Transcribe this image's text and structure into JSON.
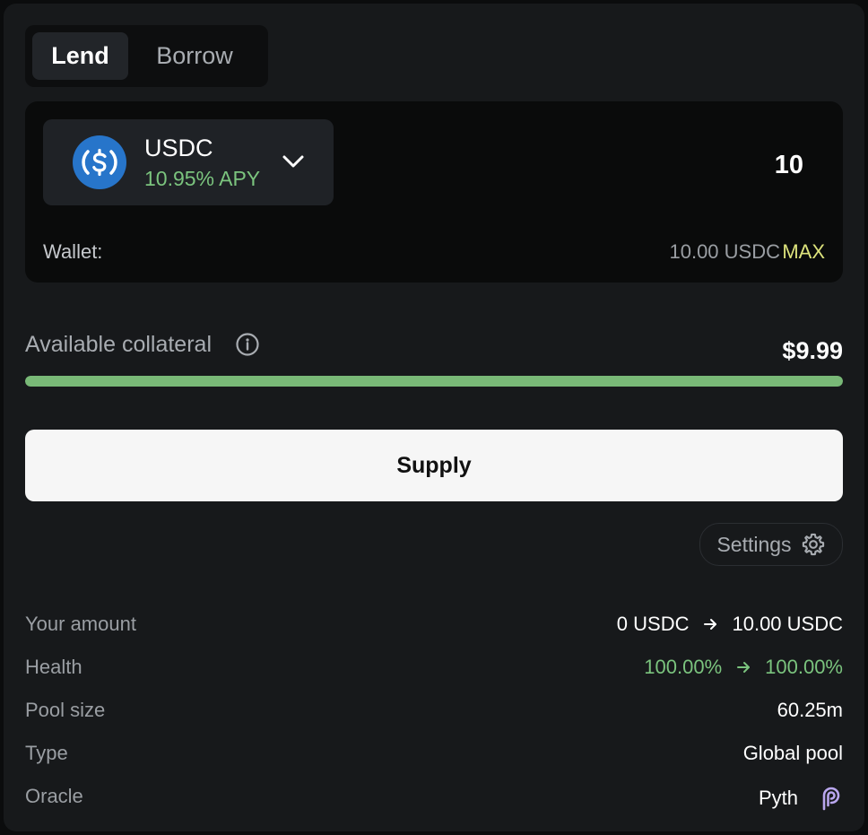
{
  "tabs": [
    {
      "label": "Lend",
      "active": true
    },
    {
      "label": "Borrow",
      "active": false
    }
  ],
  "token": {
    "symbol": "USDC",
    "apy": "10.95% APY",
    "icon": "usdc-logo",
    "brand_color": "#2775ca"
  },
  "amount": {
    "value": "10"
  },
  "wallet": {
    "label": "Wallet:",
    "balance": "10.00 USDC",
    "max_label": "MAX"
  },
  "collateral": {
    "label": "Available collateral",
    "value": "$9.99",
    "fill_fraction": 1.0
  },
  "supply_button": {
    "label": "Supply"
  },
  "settings": {
    "label": "Settings",
    "icon": "gear-icon"
  },
  "stats": {
    "your_amount": {
      "label": "Your amount",
      "from": "0 USDC",
      "to": "10.00 USDC"
    },
    "health": {
      "label": "Health",
      "from": "100.00%",
      "to": "100.00%"
    },
    "pool_size": {
      "label": "Pool size",
      "value": "60.25m"
    },
    "type": {
      "label": "Type",
      "value": "Global pool"
    },
    "oracle": {
      "label": "Oracle",
      "value": "Pyth",
      "icon": "pyth-icon"
    }
  },
  "colors": {
    "accent_green": "#7bc47e",
    "max_yellow": "#dde37c",
    "background": "#17191b"
  }
}
